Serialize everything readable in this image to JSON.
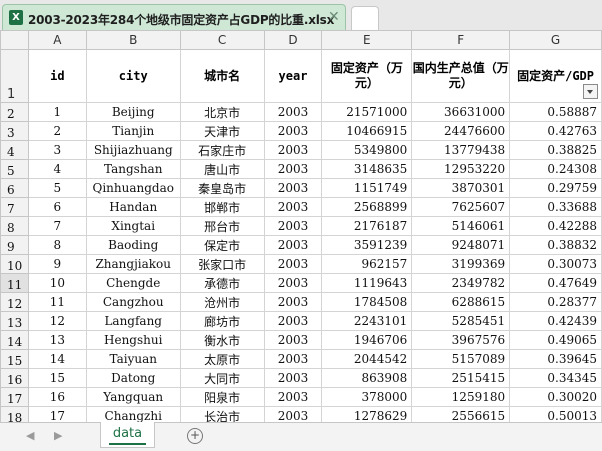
{
  "window": {
    "file_tab_title": "2003-2023年284个地级市固定资产占GDP的比重.xlsx",
    "close_glyph": "✕",
    "excel_icon_letter": "X"
  },
  "columns": [
    "A",
    "B",
    "C",
    "D",
    "E",
    "F",
    "G"
  ],
  "header_row": {
    "row_number": "1",
    "cells": [
      "id",
      "city",
      "城市名",
      "year",
      "固定资产（万元）",
      "国内生产总值（万元）",
      "固定资产/GDP"
    ]
  },
  "rows": [
    {
      "n": "2",
      "id": "1",
      "city": "Beijing",
      "cn": "北京市",
      "year": "2003",
      "fixed": "21571000",
      "gdp": "36631000",
      "ratio": "0.58887"
    },
    {
      "n": "3",
      "id": "2",
      "city": "Tianjin",
      "cn": "天津市",
      "year": "2003",
      "fixed": "10466915",
      "gdp": "24476600",
      "ratio": "0.42763"
    },
    {
      "n": "4",
      "id": "3",
      "city": "Shijiazhuang",
      "cn": "石家庄市",
      "year": "2003",
      "fixed": "5349800",
      "gdp": "13779438",
      "ratio": "0.38825"
    },
    {
      "n": "5",
      "id": "4",
      "city": "Tangshan",
      "cn": "唐山市",
      "year": "2003",
      "fixed": "3148635",
      "gdp": "12953220",
      "ratio": "0.24308"
    },
    {
      "n": "6",
      "id": "5",
      "city": "Qinhuangdao",
      "cn": "秦皇岛市",
      "year": "2003",
      "fixed": "1151749",
      "gdp": "3870301",
      "ratio": "0.29759"
    },
    {
      "n": "7",
      "id": "6",
      "city": "Handan",
      "cn": "邯郸市",
      "year": "2003",
      "fixed": "2568899",
      "gdp": "7625607",
      "ratio": "0.33688"
    },
    {
      "n": "8",
      "id": "7",
      "city": "Xingtai",
      "cn": "邢台市",
      "year": "2003",
      "fixed": "2176187",
      "gdp": "5146061",
      "ratio": "0.42288"
    },
    {
      "n": "9",
      "id": "8",
      "city": "Baoding",
      "cn": "保定市",
      "year": "2003",
      "fixed": "3591239",
      "gdp": "9248071",
      "ratio": "0.38832"
    },
    {
      "n": "10",
      "id": "9",
      "city": "Zhangjiakou",
      "cn": "张家口市",
      "year": "2003",
      "fixed": "962157",
      "gdp": "3199369",
      "ratio": "0.30073"
    },
    {
      "n": "11",
      "id": "10",
      "city": "Chengde",
      "cn": "承德市",
      "year": "2003",
      "fixed": "1119643",
      "gdp": "2349782",
      "ratio": "0.47649"
    },
    {
      "n": "12",
      "id": "11",
      "city": "Cangzhou",
      "cn": "沧州市",
      "year": "2003",
      "fixed": "1784508",
      "gdp": "6288615",
      "ratio": "0.28377"
    },
    {
      "n": "13",
      "id": "12",
      "city": "Langfang",
      "cn": "廊坊市",
      "year": "2003",
      "fixed": "2243101",
      "gdp": "5285451",
      "ratio": "0.42439"
    },
    {
      "n": "14",
      "id": "13",
      "city": "Hengshui",
      "cn": "衡水市",
      "year": "2003",
      "fixed": "1946706",
      "gdp": "3967576",
      "ratio": "0.49065"
    },
    {
      "n": "15",
      "id": "14",
      "city": "Taiyuan",
      "cn": "太原市",
      "year": "2003",
      "fixed": "2044542",
      "gdp": "5157089",
      "ratio": "0.39645"
    },
    {
      "n": "16",
      "id": "15",
      "city": "Datong",
      "cn": "大同市",
      "year": "2003",
      "fixed": "863908",
      "gdp": "2515415",
      "ratio": "0.34345"
    },
    {
      "n": "17",
      "id": "16",
      "city": "Yangquan",
      "cn": "阳泉市",
      "year": "2003",
      "fixed": "378000",
      "gdp": "1259180",
      "ratio": "0.30020"
    },
    {
      "n": "18",
      "id": "17",
      "city": "Changzhi",
      "cn": "长治市",
      "year": "2003",
      "fixed": "1278629",
      "gdp": "2556615",
      "ratio": "0.50013"
    }
  ],
  "selected_row": "11",
  "sheets": [
    {
      "name": "data",
      "active": true
    }
  ],
  "sheetbar": {
    "nav_prev": "◀",
    "nav_next": "▶",
    "add_sheet": "+"
  },
  "colors": {
    "excel_green": "#1e7145",
    "tab_bg": "#cfe8d6"
  }
}
